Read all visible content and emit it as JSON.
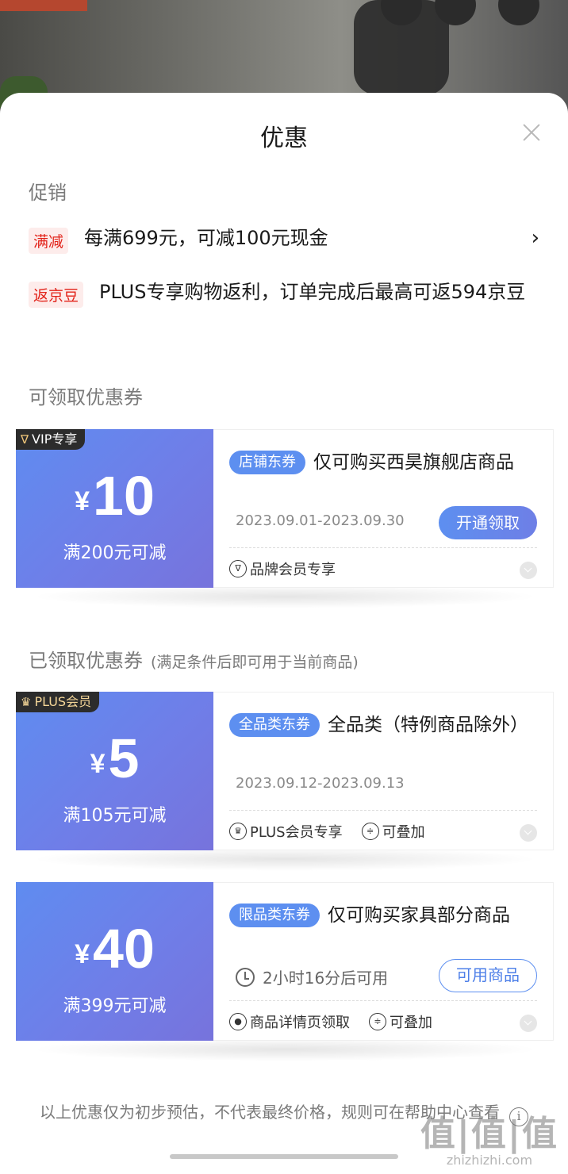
{
  "sheet": {
    "title": "优惠"
  },
  "promotions": {
    "heading": "促销",
    "items": [
      {
        "tag": "满减",
        "text": "每满699元，可减100元现金",
        "has_chevron": true
      },
      {
        "tag": "返京豆",
        "text": "PLUS专享购物返利，订单完成后最高可返594京豆",
        "has_chevron": false
      }
    ]
  },
  "available_coupons": {
    "heading": "可领取优惠券",
    "items": [
      {
        "badge": "VIP专享",
        "currency": "¥",
        "amount": "10",
        "threshold": "满200元可减",
        "type": "店铺东券",
        "description": "仅可购买西昊旗舰店商品",
        "date_range": "2023.09.01-2023.09.30",
        "button": "开通领取",
        "tags": [
          "品牌会员专享"
        ]
      }
    ]
  },
  "claimed_coupons": {
    "heading": "已领取优惠券",
    "note": "(满足条件后即可用于当前商品)",
    "items": [
      {
        "badge": "PLUS会员",
        "currency": "¥",
        "amount": "5",
        "threshold": "满105元可减",
        "type": "全品类东券",
        "description": "全品类（特例商品除外）",
        "date_range": "2023.09.12-2023.09.13",
        "tags": [
          "PLUS会员专享",
          "可叠加"
        ]
      },
      {
        "currency": "¥",
        "amount": "40",
        "threshold": "满399元可减",
        "type": "限品类东券",
        "description": "仅可购买家具部分商品",
        "countdown": "2小时16分后可用",
        "button": "可用商品",
        "tags": [
          "商品详情页领取",
          "可叠加"
        ]
      }
    ]
  },
  "footer": {
    "note": "以上优惠仅为初步预估，不代表最终价格，规则可在帮助中心查看"
  },
  "watermark": {
    "logo": "值|值|值",
    "url": "zhizhizhi.com"
  },
  "colors": {
    "coupon_blue": "#5d8ff0",
    "promo_red": "#e2231a"
  }
}
